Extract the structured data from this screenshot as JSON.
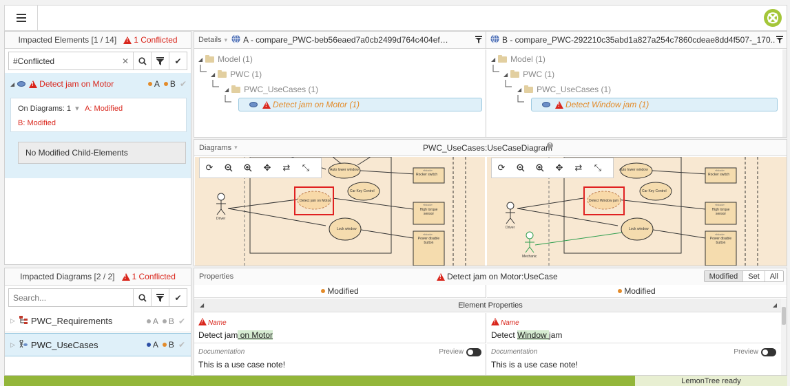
{
  "top": {
    "menu_icon": "hamburger-icon",
    "logo_icon": "lemontree-logo-icon"
  },
  "left_top": {
    "header_title": "Impacted Elements [1 / 14]",
    "header_conflict": "1 Conflicted",
    "search_value": "#Conflicted",
    "item": {
      "label": "Detect jam on Motor",
      "a": "A",
      "b": "B"
    },
    "on_diagrams": "On Diagrams: 1",
    "a_modified": "A: Modified",
    "b_modified": "B: Modified",
    "child_box": "No Modified Child-Elements"
  },
  "left_bottom": {
    "header_title": "Impacted Diagrams [2 / 2]",
    "header_conflict": "1 Conflicted",
    "search_placeholder": "Search...",
    "rows": [
      {
        "label": "PWC_Requirements",
        "a": "A",
        "b": "B"
      },
      {
        "label": "PWC_UseCases",
        "a": "A",
        "b": "B"
      }
    ]
  },
  "details": {
    "label": "Details",
    "a_title": "A - compare_PWC-beb56eaed7a0cb2499d764c404ef…",
    "b_title": "B - compare_PWC-292210c35abd1a827a254c7860cdeae8dd4f507-_170..",
    "a_tree": [
      "Model (1)",
      "PWC (1)",
      "PWC_UseCases (1)",
      "Detect jam on Motor (1)"
    ],
    "b_tree": [
      "Model (1)",
      "PWC (1)",
      "PWC_UseCases (1)",
      "Detect Window jam (1)"
    ]
  },
  "diagrams": {
    "label": "Diagrams",
    "title": "PWC_UseCases:UseCaseDiagram",
    "a_labels": {
      "auto": "Auto lower window",
      "rocker": "Rocker switch",
      "block": "«block»",
      "carkey": "Car Key Control",
      "detect": "Detect jam on Motor",
      "torque": "High torque sensor",
      "driver": "Driver",
      "lock": "Lock window",
      "power": "Power disable button"
    },
    "b_labels": {
      "auto": "Auto lower window",
      "rocker": "Rocker switch",
      "block": "«block»",
      "carkey": "Car Key Control",
      "detect": "Detect Window jam",
      "torque": "High torque sensor",
      "driver": "Driver",
      "lock": "Lock window",
      "power": "Power disable button",
      "mechanic": "Mechanic"
    }
  },
  "properties": {
    "label": "Properties",
    "title": "Detect jam on Motor:UseCase",
    "seg": [
      "Modified",
      "Set",
      "All"
    ],
    "a_status": "Modified",
    "b_status": "Modified",
    "section": "Element Properties",
    "name_label": "Name",
    "a_name_pre": "Detect jam",
    "a_name_hl": " on Motor",
    "b_name_pre": "Detect ",
    "b_name_hl": "Window ",
    "b_name_post": "jam",
    "doc_label": "Documentation",
    "preview": "Preview",
    "doc_value": "This is a use case note!"
  },
  "status": {
    "text": "LemonTree ready"
  },
  "colors": {
    "conflict": "#d9261c",
    "modified": "#e38b2a",
    "status_bar": "#93b63a",
    "selected": "#dff0f9"
  }
}
